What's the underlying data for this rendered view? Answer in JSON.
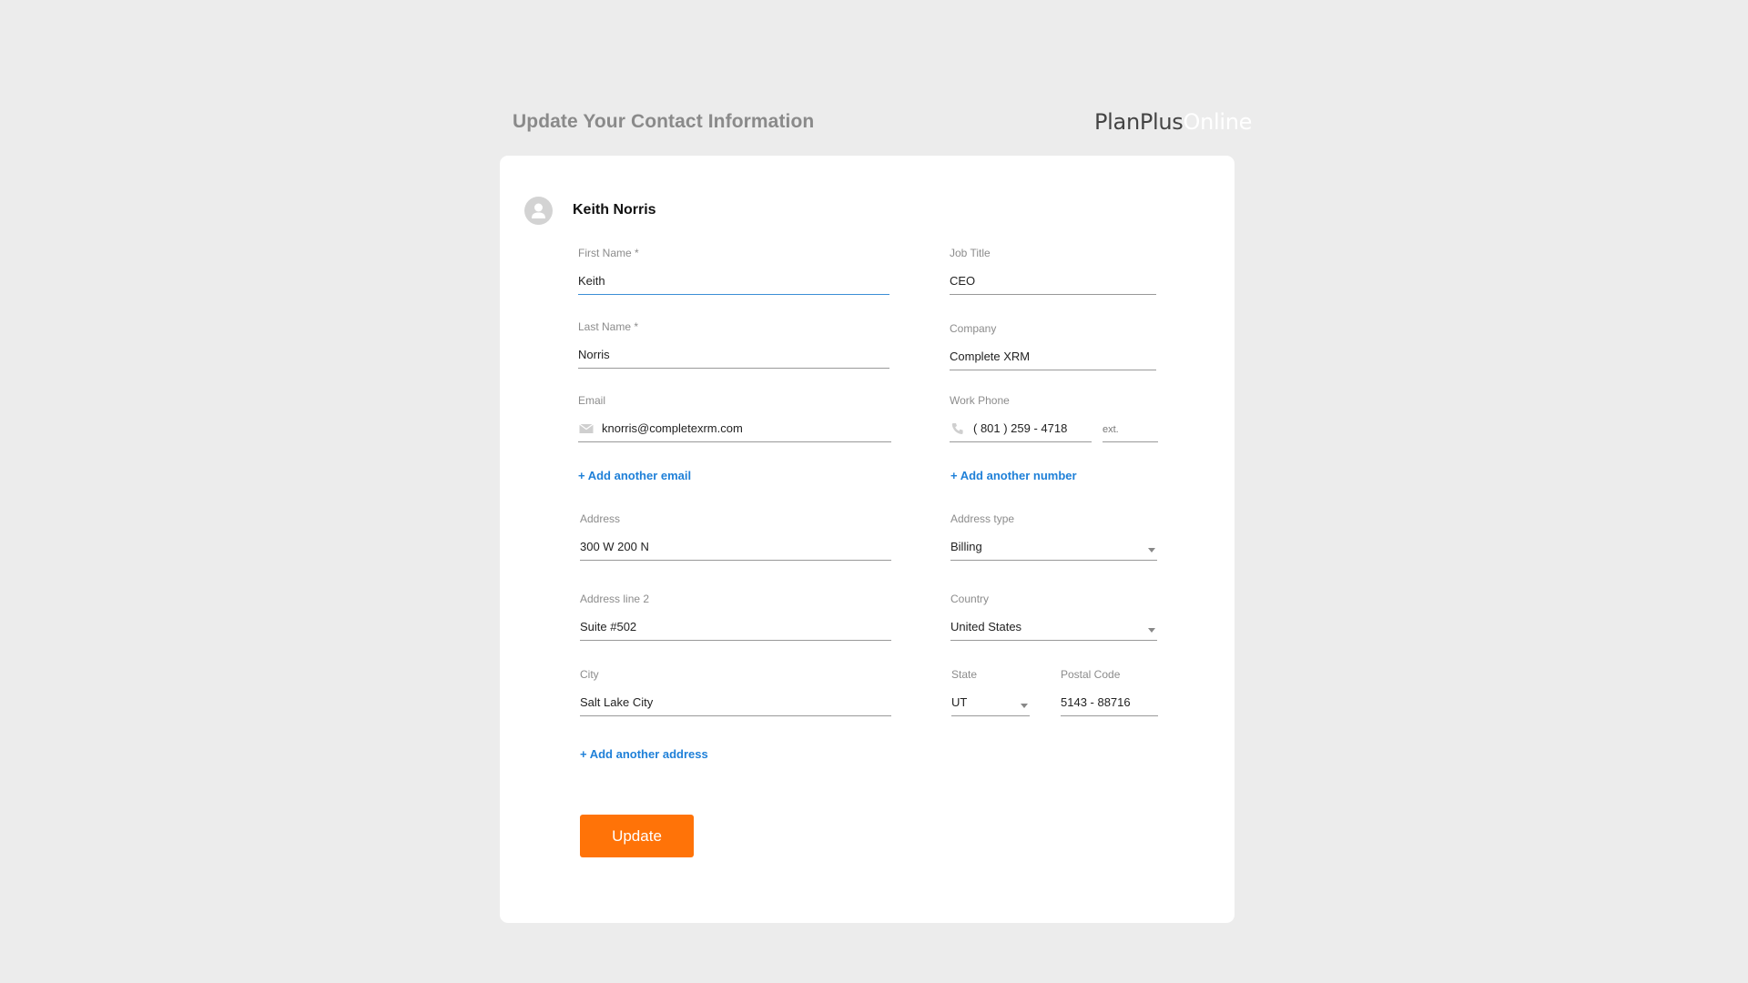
{
  "header": {
    "title": "Update Your Contact Information",
    "logo_main": "PlanPlus",
    "logo_sub": "Online"
  },
  "card": {
    "user_name": "Keith Norris"
  },
  "form": {
    "first_name": {
      "label": "First Name *",
      "value": "Keith"
    },
    "last_name": {
      "label": "Last Name *",
      "value": "Norris"
    },
    "email": {
      "label": "Email",
      "value": "knorris@completexrm.com"
    },
    "job_title": {
      "label": "Job Title",
      "value": "CEO"
    },
    "company": {
      "label": "Company",
      "value": "Complete XRM"
    },
    "work_phone": {
      "label": "Work Phone",
      "value": "( 801 ) 259 - 4718",
      "ext_placeholder": "ext."
    },
    "address": {
      "label": "Address",
      "value": "300 W 200 N"
    },
    "address_line2": {
      "label": "Address line 2",
      "value": "Suite #502"
    },
    "city": {
      "label": "City",
      "value": "Salt Lake City"
    },
    "address_type": {
      "label": "Address type",
      "value": "Billing"
    },
    "country": {
      "label": "Country",
      "value": "United States"
    },
    "state": {
      "label": "State",
      "value": "UT"
    },
    "postal_code": {
      "label": "Postal Code",
      "value": "5143 - 88716"
    }
  },
  "links": {
    "add_email": "+ Add another email",
    "add_number": "+ Add another number",
    "add_address": "+ Add another address"
  },
  "actions": {
    "update_label": "Update"
  },
  "colors": {
    "accent_button": "#ff7308",
    "link": "#1f80d8",
    "active_underline": "#3c8fd6"
  },
  "icons": {
    "avatar": "person-icon",
    "email": "envelope-icon",
    "phone": "phone-icon",
    "dropdown": "caret-down-icon"
  }
}
